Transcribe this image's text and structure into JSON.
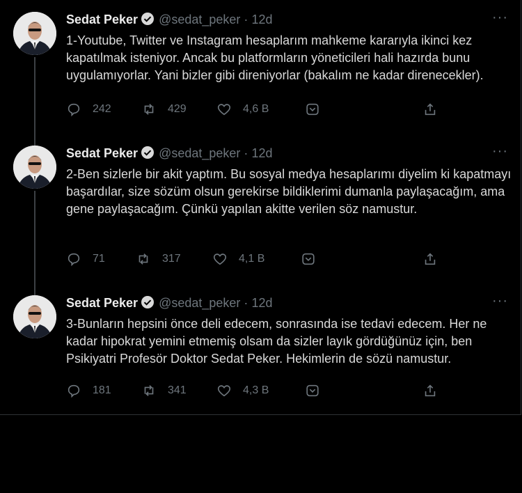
{
  "tweets": [
    {
      "name": "Sedat Peker",
      "handle": "@sedat_peker",
      "separator": "·",
      "time": "12d",
      "more": "···",
      "text": "1-Youtube, Twitter ve Instagram hesaplarım mahkeme kararıyla ikinci kez kapatılmak isteniyor. Ancak bu platformların yöneticileri hali hazırda bunu uygulamıyorlar. Yani bizler gibi direniyorlar (bakalım ne kadar direnecekler).",
      "replies": "242",
      "retweets": "429",
      "likes": "4,6 B"
    },
    {
      "name": "Sedat Peker",
      "handle": "@sedat_peker",
      "separator": "·",
      "time": "12d",
      "more": "···",
      "text": "2-Ben sizlerle bir akit yaptım. Bu sosyal medya hesaplarımı diyelim ki kapatmayı başardılar, size sözüm olsun gerekirse bildiklerimi dumanla paylaşacağım, ama gene paylaşacağım. Çünkü yapılan akitte verilen söz namustur.",
      "replies": "71",
      "retweets": "317",
      "likes": "4,1 B"
    },
    {
      "name": "Sedat Peker",
      "handle": "@sedat_peker",
      "separator": "·",
      "time": "12d",
      "more": "···",
      "text": "3-Bunların hepsini önce deli edecem, sonrasında ise tedavi edecem. Her ne kadar hipokrat yemini etmemiş olsam da sizler layık gördüğünüz için, ben Psikiyatri Profesör Doktor Sedat Peker. Hekimlerin de sözü namustur.",
      "replies": "181",
      "retweets": "341",
      "likes": "4,3 B"
    }
  ],
  "icons": [
    "verified-icon",
    "more-icon",
    "reply-icon",
    "retweet-icon",
    "like-icon",
    "bookmark-icon",
    "share-icon"
  ],
  "colors": {
    "background": "#000000",
    "text": "#d9d9d9",
    "muted": "#6e767d",
    "border": "#2f3336"
  }
}
